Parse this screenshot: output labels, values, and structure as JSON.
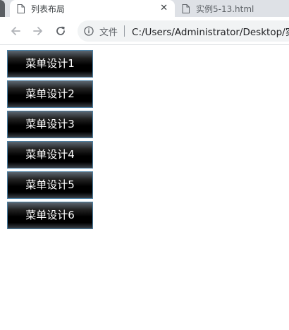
{
  "browser": {
    "tabs": [
      {
        "title": "列表布局",
        "active": true,
        "close_glyph": "✕"
      },
      {
        "title": "实例5-13.html",
        "active": false
      }
    ],
    "security_label": "文件",
    "url": "C:/Users/Administrator/Desktop/实",
    "icons": {
      "back": "arrow-left-icon",
      "forward": "arrow-right-icon",
      "reload": "reload-icon",
      "info": "info-icon",
      "tab": "document-icon"
    }
  },
  "page": {
    "menu_items": [
      "菜单设计1",
      "菜单设计2",
      "菜单设计3",
      "菜单设计4",
      "菜单设计5",
      "菜单设计6"
    ]
  },
  "colors": {
    "tabstrip": "#dee1e6",
    "omnibox": "#f1f3f4",
    "menu_border": "#4a7fa3",
    "menu_bg": "#000000",
    "menu_text": "#ffffff"
  }
}
